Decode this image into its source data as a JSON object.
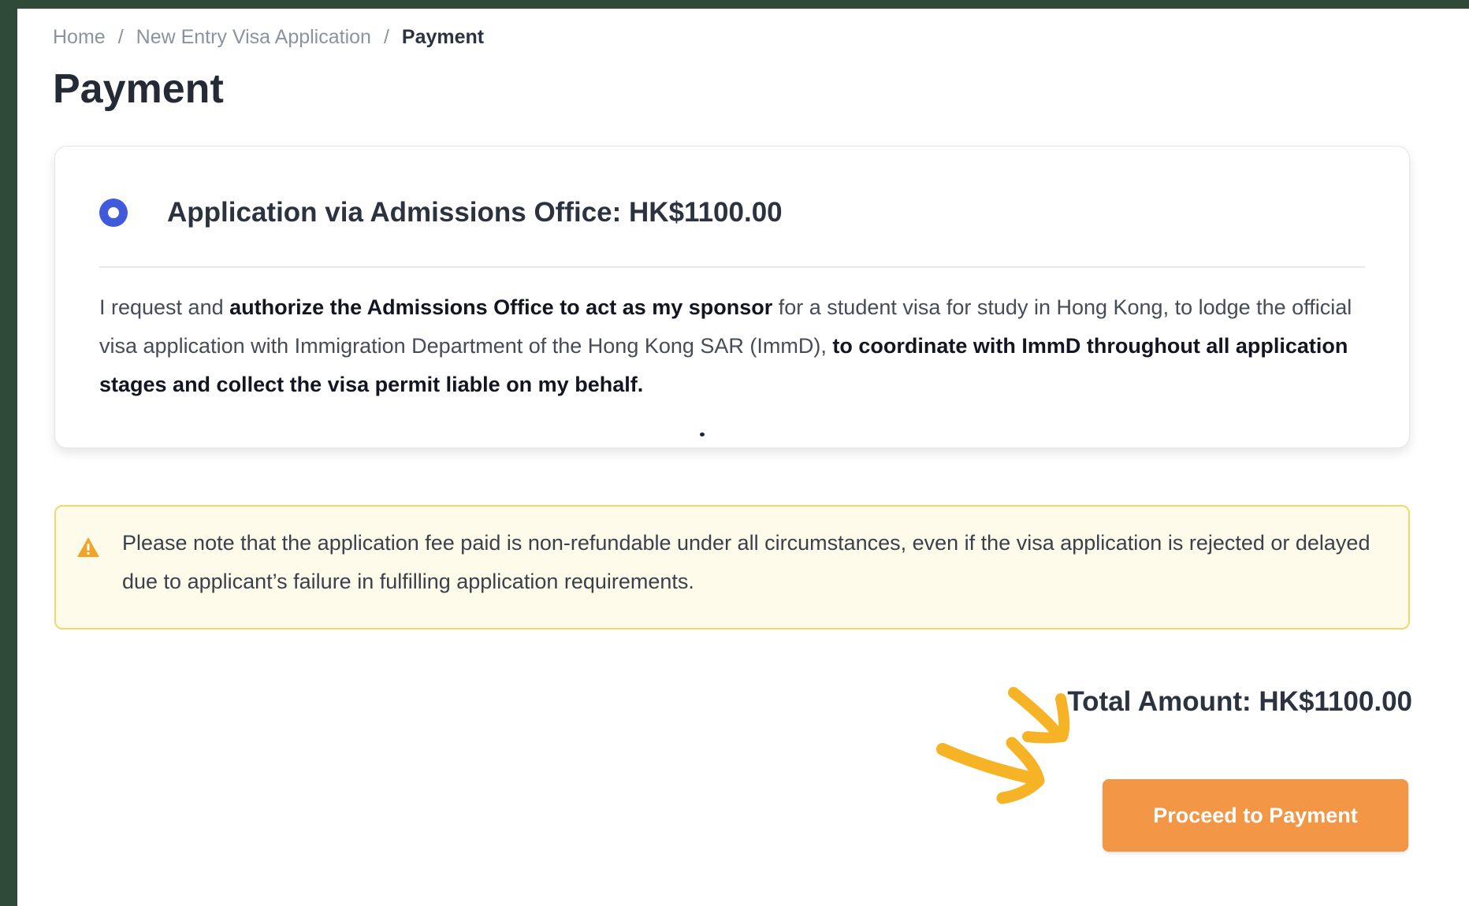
{
  "breadcrumb": {
    "items": [
      "Home",
      "New Entry Visa Application"
    ],
    "separator": "/",
    "current": "Payment"
  },
  "page_title": "Payment",
  "option": {
    "label": "Application via Admissions Office: HK$1100.00",
    "selected": true,
    "description": {
      "part1": "I request and ",
      "bold1": "authorize the Admissions Office to act as my sponsor",
      "part2": " for a student visa for study in Hong Kong, to lodge the official visa application with Immigration Department of the Hong Kong SAR (ImmD), ",
      "bold2": "to coordinate with ImmD throughout all application stages and collect the visa permit liable on my behalf."
    }
  },
  "warning": {
    "icon": "warning-triangle-icon",
    "text": "Please note that the application fee paid is non-refundable under all circumstances, even if the visa application is rejected or delayed due to applicant’s failure in fulfilling application requirements."
  },
  "total": {
    "text": "Total Amount: HK$1100.00"
  },
  "proceed_button": {
    "label": "Proceed to Payment"
  },
  "colors": {
    "background": "#2f4a39",
    "radio": "#3f5bdb",
    "warning_bg": "#fffbea",
    "warning_border": "#f6d66a",
    "button": "#f39646",
    "annotation_arrow": "#f6b326"
  }
}
